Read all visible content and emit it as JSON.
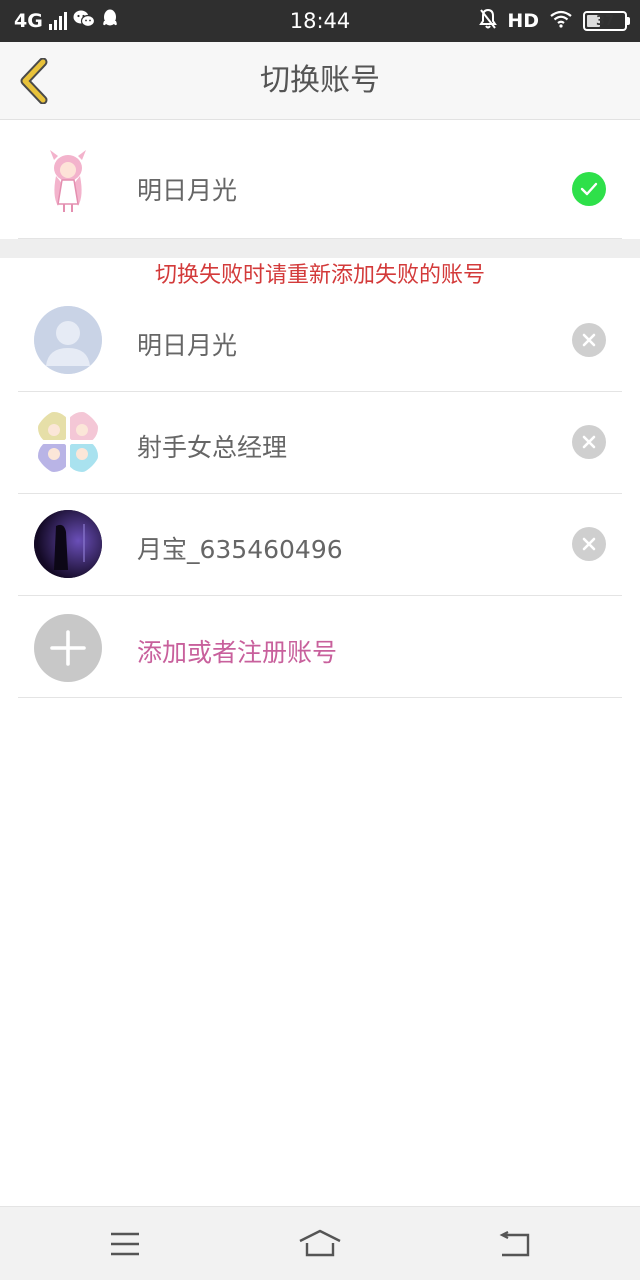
{
  "status_bar": {
    "network": "4G",
    "time": "18:44",
    "hd": "HD",
    "battery": "37",
    "battery_level": 0.37
  },
  "header": {
    "title": "切换账号"
  },
  "current_account": {
    "name": "明日月光"
  },
  "warning_text": "切换失败时请重新添加失败的账号",
  "accounts": [
    {
      "name": "明日月光"
    },
    {
      "name": "射手女总经理"
    },
    {
      "name": "月宝_635460496"
    }
  ],
  "add_account_label": "添加或者注册账号",
  "colors": {
    "accent_check": "#2ee04a",
    "warning": "#d33a3a",
    "add_label": "#c8609c",
    "back_arrow": "#e8c23a"
  },
  "icons": {
    "back": "chevron-left-icon",
    "check": "check-circle-icon",
    "remove": "close-circle-icon",
    "add": "plus-icon",
    "menu": "menu-icon",
    "home": "home-icon",
    "back_nav": "return-icon"
  }
}
